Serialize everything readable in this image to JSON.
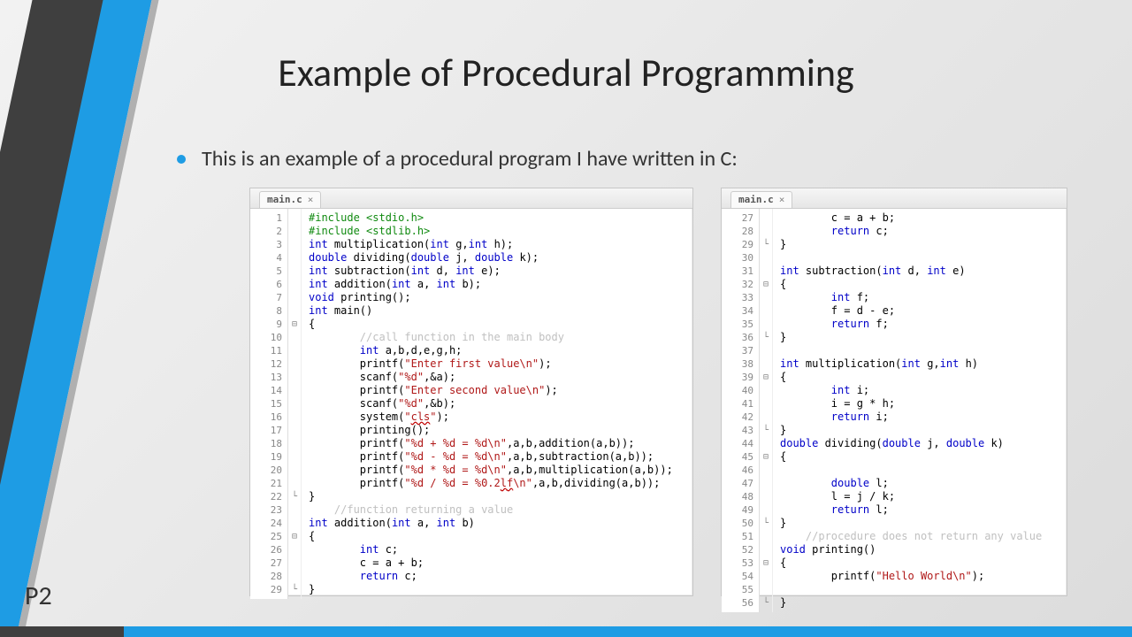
{
  "title": "Example of Procedural Programming",
  "bullet": "This is an example of a procedural program I have written in C:",
  "pageLabel": "P2",
  "tabName": "main.c",
  "leftStart": 1,
  "rightStart": 27,
  "leftCode": [
    {
      "pp": "#include <stdio.h>"
    },
    {
      "pp": "#include <stdlib.h>"
    },
    {
      "raw": "<span class='kw'>int</span> multiplication(<span class='kw'>int</span> g,<span class='kw'>int</span> h);"
    },
    {
      "raw": "<span class='kw'>double</span> dividing(<span class='kw'>double</span> j, <span class='kw'>double</span> k);"
    },
    {
      "raw": "<span class='kw'>int</span> subtraction(<span class='kw'>int</span> d, <span class='kw'>int</span> e);"
    },
    {
      "raw": "<span class='kw'>int</span> addition(<span class='kw'>int</span> a, <span class='kw'>int</span> b);"
    },
    {
      "raw": "<span class='kw'>void</span> printing();"
    },
    {
      "raw": "<span class='kw'>int</span> main()"
    },
    {
      "txt": "{",
      "fold": "⊟"
    },
    {
      "indent": 2,
      "cmt": "//call function in the main body"
    },
    {
      "indent": 2,
      "raw": "<span class='kw'>int</span> a,b,d,e,g,h;"
    },
    {
      "indent": 2,
      "raw": "printf(<span class='str'>\"Enter first value\\n\"</span>);"
    },
    {
      "indent": 2,
      "raw": "scanf(<span class='str'>\"%d\"</span>,&a);"
    },
    {
      "indent": 2,
      "raw": "printf(<span class='str'>\"Enter second value\\n\"</span>);"
    },
    {
      "indent": 2,
      "raw": "scanf(<span class='str'>\"%d\"</span>,&b);"
    },
    {
      "indent": 2,
      "raw": "system(<span class='str'>\"<span class='err'>cls</span>\"</span>);"
    },
    {
      "indent": 2,
      "txt": "printing();"
    },
    {
      "indent": 2,
      "raw": "printf(<span class='str'>\"%d + %d = %d\\n\"</span>,a,b,addition(a,b));"
    },
    {
      "indent": 2,
      "raw": "printf(<span class='str'>\"%d - %d = %d\\n\"</span>,a,b,subtraction(a,b));"
    },
    {
      "indent": 2,
      "raw": "printf(<span class='str'>\"%d * %d = %d\\n\"</span>,a,b,multiplication(a,b));"
    },
    {
      "indent": 2,
      "raw": "printf(<span class='str'>\"%d / %d = %0.2<span class='err'>lf</span>\\n\"</span>,a,b,dividing(a,b));"
    },
    {
      "txt": "}",
      "fold": "└"
    },
    {
      "indent": 1,
      "cmt": "//function returning a value"
    },
    {
      "raw": "<span class='kw'>int</span> addition(<span class='kw'>int</span> a, <span class='kw'>int</span> b)"
    },
    {
      "txt": "{",
      "fold": "⊟"
    },
    {
      "indent": 2,
      "raw": "<span class='kw'>int</span> c;"
    },
    {
      "indent": 2,
      "txt": "c = a + b;"
    },
    {
      "indent": 2,
      "raw": "<span class='kw'>return</span> c;"
    },
    {
      "txt": "}",
      "fold": "└"
    }
  ],
  "rightCode": [
    {
      "indent": 2,
      "txt": "c = a + b;"
    },
    {
      "indent": 2,
      "raw": "<span class='kw'>return</span> c;"
    },
    {
      "txt": "}",
      "fold": "└"
    },
    {
      "txt": ""
    },
    {
      "raw": "<span class='kw'>int</span> subtraction(<span class='kw'>int</span> d, <span class='kw'>int</span> e)"
    },
    {
      "txt": "{",
      "fold": "⊟"
    },
    {
      "indent": 2,
      "raw": "<span class='kw'>int</span> f;"
    },
    {
      "indent": 2,
      "txt": "f = d - e;"
    },
    {
      "indent": 2,
      "raw": "<span class='kw'>return</span> f;"
    },
    {
      "txt": "}",
      "fold": "└"
    },
    {
      "txt": ""
    },
    {
      "raw": "<span class='kw'>int</span> multiplication(<span class='kw'>int</span> g,<span class='kw'>int</span> h)"
    },
    {
      "txt": "{",
      "fold": "⊟"
    },
    {
      "indent": 2,
      "raw": "<span class='kw'>int</span> i;"
    },
    {
      "indent": 2,
      "txt": "i = g * h;"
    },
    {
      "indent": 2,
      "raw": "<span class='kw'>return</span> i;"
    },
    {
      "txt": "}",
      "fold": "└"
    },
    {
      "raw": "<span class='kw'>double</span> dividing(<span class='kw'>double</span> j, <span class='kw'>double</span> k)"
    },
    {
      "txt": "{",
      "fold": "⊟"
    },
    {
      "txt": ""
    },
    {
      "indent": 2,
      "raw": "<span class='kw'>double</span> l;"
    },
    {
      "indent": 2,
      "txt": "l = j / k;"
    },
    {
      "indent": 2,
      "raw": "<span class='kw'>return</span> l;"
    },
    {
      "txt": "}",
      "fold": "└"
    },
    {
      "indent": 1,
      "cmt": "//procedure does not return any value"
    },
    {
      "raw": "<span class='kw'>void</span> printing()"
    },
    {
      "txt": "{",
      "fold": "⊟"
    },
    {
      "indent": 2,
      "raw": "printf(<span class='str'>\"Hello World\\n\"</span>);"
    },
    {
      "txt": ""
    },
    {
      "txt": "}",
      "fold": "└"
    }
  ]
}
